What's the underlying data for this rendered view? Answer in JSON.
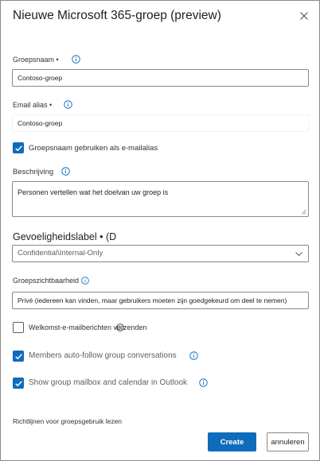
{
  "dialog": {
    "title": "Nieuwe Microsoft 365-groep (preview)",
    "close_icon": "close-icon"
  },
  "group_name": {
    "label": "Groepsnaam •",
    "value": "Contoso-groep",
    "info_icon": "info-icon"
  },
  "email_alias": {
    "label": "Email alias •",
    "value": "Contoso-groep",
    "info_icon": "info-icon"
  },
  "use_group_name_checkbox": {
    "label": "Groepsnaam gebruiken als e-mailalias",
    "checked": true
  },
  "description": {
    "label": "Beschrijving",
    "value": "Personen vertellen wat het doelvan uw groep is",
    "info_icon": "info-icon"
  },
  "sensitivity": {
    "label": "Gevoeligheidslabel • (D",
    "selected": "Confidential\\Internal-Only",
    "chevron_icon": "chevron-down-icon"
  },
  "privacy": {
    "label": "Groepszichtbaarheid",
    "value": "Privé (iedereen kan vinden, maar gebruikers moeten zijn goedgekeurd om deel te nemen)"
  },
  "options": [
    {
      "label": "Welkomst-e-mailberichten verzenden",
      "checked": false
    },
    {
      "label": "Members auto-follow group conversations",
      "checked": true
    },
    {
      "label": "Show group mailbox and calendar in Outlook",
      "checked": true
    }
  ],
  "footer": {
    "guidelines_link": "Richtlijnen voor groepsgebruik lezen",
    "create_label": "Create",
    "cancel_label": "annuleren"
  },
  "colors": {
    "accent": "#0f6cbd",
    "text": "#323130",
    "border": "#8a8886"
  }
}
